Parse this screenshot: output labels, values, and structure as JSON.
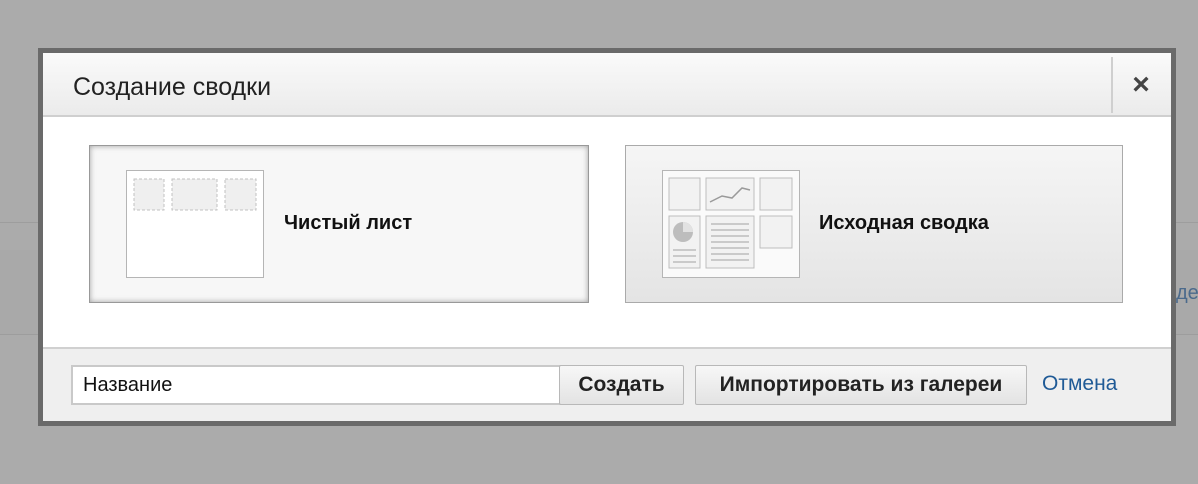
{
  "background": {
    "link_fragment": "де"
  },
  "dialog": {
    "title": "Создание сводки",
    "close_symbol": "×",
    "options": {
      "blank_label": "Чистый лист",
      "default_label": "Исходная сводка"
    },
    "footer": {
      "name_value": "Название",
      "create_label": "Создать",
      "import_label": "Импортировать из галереи",
      "cancel_label": "Отмена"
    }
  },
  "icons": {
    "close": "close-icon",
    "blank_thumb": "blank-dashboard-thumbnail-icon",
    "default_thumb": "default-dashboard-thumbnail-icon"
  },
  "colors": {
    "overlay": "#ababab",
    "dialog_border": "#6a6a6a",
    "link": "#1f5a96"
  }
}
